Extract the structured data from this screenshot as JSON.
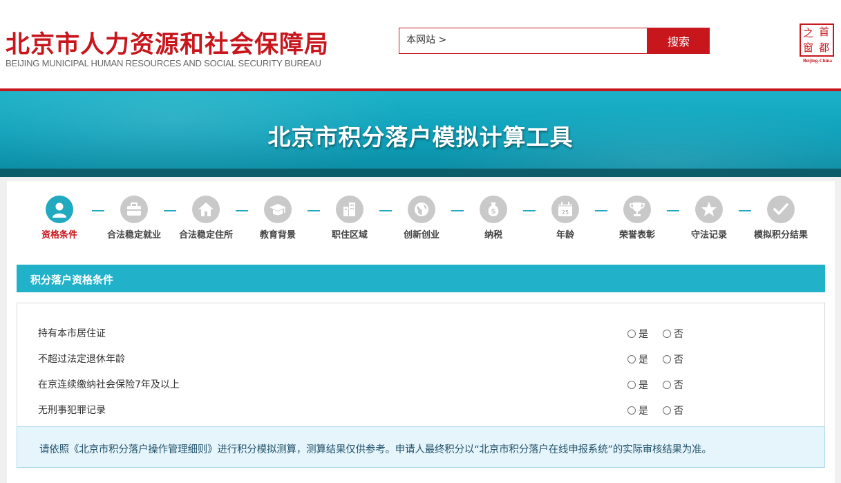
{
  "header": {
    "logo_cn": "北京市人力资源和社会保障局",
    "logo_en": "BEIJING MUNICIPAL HUMAN RESOURCES AND SOCIAL SECURITY BUREAU",
    "search_scope": "本网站 >",
    "search_value": "",
    "search_button": "搜索",
    "seal_chars": [
      "之",
      "首",
      "窗",
      "都"
    ],
    "seal_text": "Beijing-China"
  },
  "banner": {
    "title": "北京市积分落户模拟计算工具"
  },
  "steps": [
    {
      "label": "资格条件",
      "icon": "user-icon",
      "active": true
    },
    {
      "label": "合法稳定就业",
      "icon": "briefcase-icon",
      "active": false
    },
    {
      "label": "合法稳定住所",
      "icon": "house-icon",
      "active": false
    },
    {
      "label": "教育背景",
      "icon": "graduation-cap-icon",
      "active": false
    },
    {
      "label": "职住区域",
      "icon": "buildings-icon",
      "active": false
    },
    {
      "label": "创新创业",
      "icon": "globe-icon",
      "active": false
    },
    {
      "label": "纳税",
      "icon": "money-bag-icon",
      "active": false
    },
    {
      "label": "年龄",
      "icon": "calendar-icon",
      "active": false
    },
    {
      "label": "荣誉表彰",
      "icon": "trophy-icon",
      "active": false
    },
    {
      "label": "守法记录",
      "icon": "star-icon",
      "active": false
    },
    {
      "label": "模拟积分结果",
      "icon": "check-icon",
      "active": false
    }
  ],
  "section": {
    "title": "积分落户资格条件"
  },
  "questions": [
    {
      "text": "持有本市居住证",
      "yes": "是",
      "no": "否"
    },
    {
      "text": "不超过法定退休年龄",
      "yes": "是",
      "no": "否"
    },
    {
      "text": "在京连续缴纳社会保险7年及以上",
      "yes": "是",
      "no": "否"
    },
    {
      "text": "无刑事犯罪记录",
      "yes": "是",
      "no": "否"
    }
  ],
  "notice": "请依照《北京市积分落户操作管理细则》进行积分模拟测算，测算结果仅供参考。申请人最终积分以“北京市积分落户在线申报系统”的实际审核结果为准。",
  "colors": {
    "brand_red": "#c8161d",
    "teal": "#21b1c9",
    "step_inactive": "#c9c9c9"
  }
}
